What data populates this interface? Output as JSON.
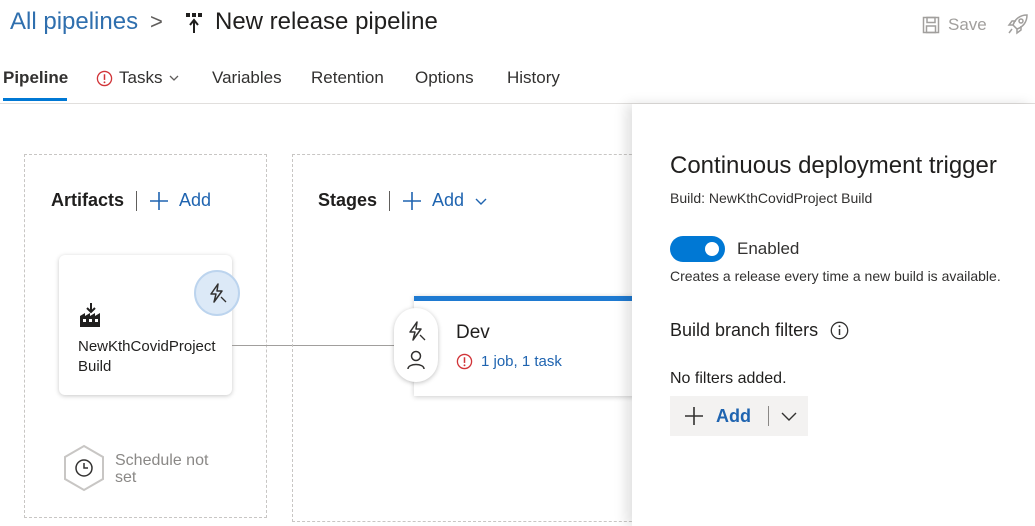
{
  "header": {
    "breadcrumb_root": "All pipelines",
    "breadcrumb_sep": ">",
    "title": "New release pipeline",
    "save_label": "Save"
  },
  "tabs": [
    {
      "label": "Pipeline",
      "active": true
    },
    {
      "label": "Tasks",
      "warning": true
    },
    {
      "label": "Variables"
    },
    {
      "label": "Retention"
    },
    {
      "label": "Options"
    },
    {
      "label": "History"
    }
  ],
  "artifacts": {
    "heading": "Artifacts",
    "add_label": "Add",
    "card_name": "NewKthCovidProject Build",
    "schedule_text": "Schedule not set"
  },
  "stages": {
    "heading": "Stages",
    "add_label": "Add",
    "stage_name": "Dev",
    "stage_tasks": "1 job, 1 task"
  },
  "trigger_panel": {
    "title": "Continuous deployment trigger",
    "subtitle": "Build: NewKthCovidProject Build",
    "toggle_label": "Enabled",
    "toggle_on": true,
    "toggle_desc": "Creates a release every time a new build is available.",
    "filters_heading": "Build branch filters",
    "no_filters": "No filters added.",
    "add_label": "Add"
  },
  "colors": {
    "accent": "#0078d4",
    "link": "#1f64b0",
    "warning": "#d13438"
  }
}
